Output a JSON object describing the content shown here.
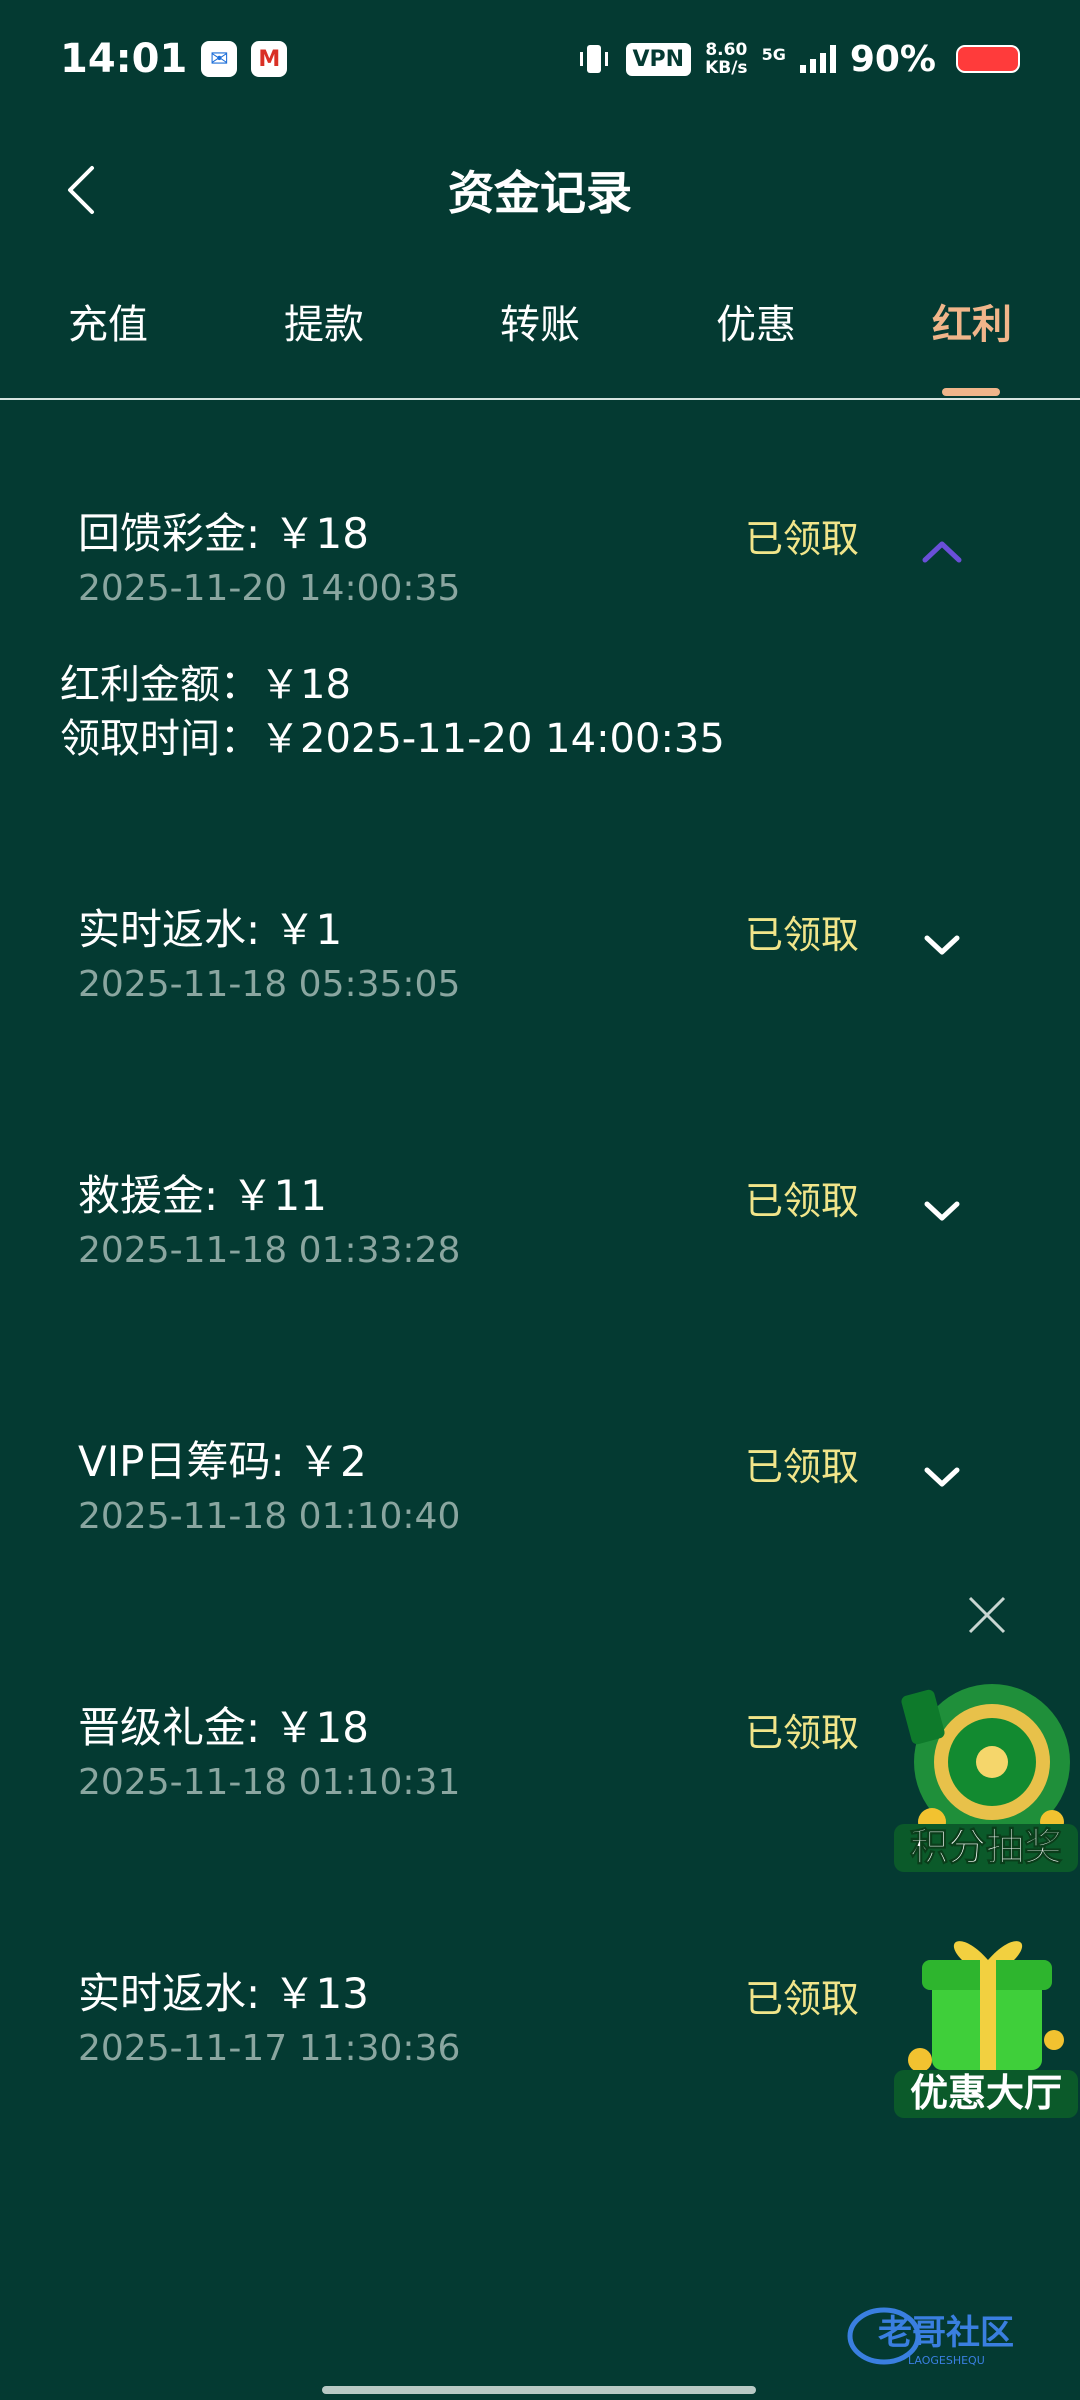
{
  "status_bar": {
    "time": "14:01",
    "vpn": "VPN",
    "speed_value": "8.60",
    "speed_unit": "KB/s",
    "network": "5G",
    "battery": "90%"
  },
  "header": {
    "title": "资金记录"
  },
  "tabs": [
    {
      "label": "充值",
      "active": false
    },
    {
      "label": "提款",
      "active": false
    },
    {
      "label": "转账",
      "active": false
    },
    {
      "label": "优惠",
      "active": false
    },
    {
      "label": "红利",
      "active": true
    }
  ],
  "records": [
    {
      "title": "回馈彩金: ￥18",
      "date": "2025-11-20 14:00:35",
      "status": "已领取",
      "expanded": true,
      "detail_amount": "红利金额：￥18",
      "detail_time": "领取时间：￥2025-11-20 14:00:35"
    },
    {
      "title": "实时返水: ￥1",
      "date": "2025-11-18 05:35:05",
      "status": "已领取",
      "expanded": false
    },
    {
      "title": "救援金: ￥11",
      "date": "2025-11-18 01:33:28",
      "status": "已领取",
      "expanded": false
    },
    {
      "title": "VIP日筹码: ￥2",
      "date": "2025-11-18 01:10:40",
      "status": "已领取",
      "expanded": false
    },
    {
      "title": "晋级礼金: ￥18",
      "date": "2025-11-18 01:10:31",
      "status": "已领取",
      "expanded": false
    },
    {
      "title": "实时返水: ￥13",
      "date": "2025-11-17 11:30:36",
      "status": "已领取",
      "expanded": false
    }
  ],
  "floating": {
    "lottery_label": "积分抽奖",
    "promo_label": "优惠大厅"
  },
  "watermark": {
    "text": "老哥社区",
    "sub": "LAOGESHEQU"
  },
  "colors": {
    "background": "#043a32",
    "accent_tab": "#f0b58a",
    "status_text": "#f1e58a",
    "date_text": "#8aa6a0"
  }
}
